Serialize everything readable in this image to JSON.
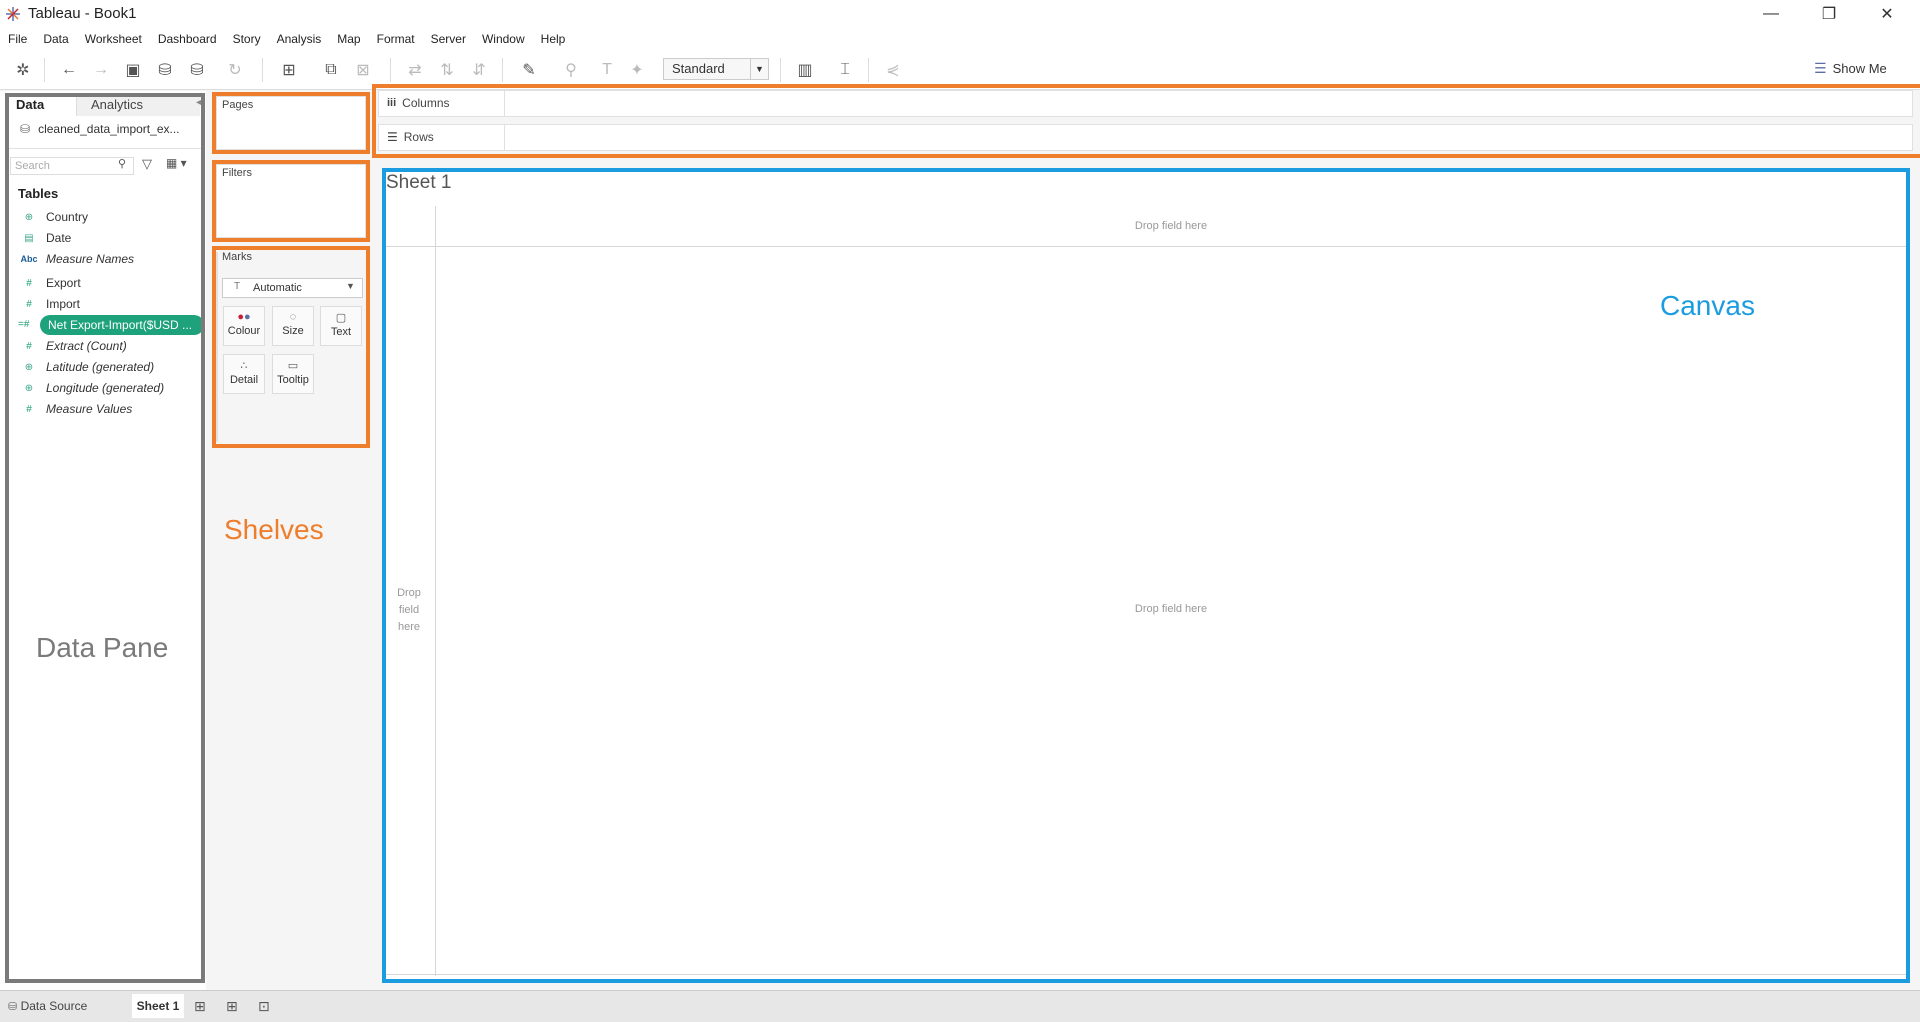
{
  "window": {
    "title": "Tableau - Book1",
    "minimize": "—",
    "restore": "❐",
    "close": "✕"
  },
  "menu": [
    "File",
    "Data",
    "Worksheet",
    "Dashboard",
    "Story",
    "Analysis",
    "Map",
    "Format",
    "Server",
    "Window",
    "Help"
  ],
  "toolbar": {
    "fit_select": "Standard",
    "show_me": "Show Me"
  },
  "data_pane": {
    "tabs": {
      "data": "Data",
      "analytics": "Analytics"
    },
    "datasource": "cleaned_data_import_ex...",
    "search_placeholder": "Search",
    "tables_header": "Tables",
    "fields": [
      {
        "name": "Country",
        "icon": "globe-icon"
      },
      {
        "name": "Date",
        "icon": "calendar-icon"
      },
      {
        "name": "Measure Names",
        "icon": "abc-icon"
      },
      {
        "name": "Export",
        "icon": "hash-icon"
      },
      {
        "name": "Import",
        "icon": "hash-icon"
      },
      {
        "name": "Net Export-Import($USD ...",
        "icon": "calc-hash-icon"
      },
      {
        "name": "Extract (Count)",
        "icon": "hash-icon"
      },
      {
        "name": "Latitude (generated)",
        "icon": "globe-icon"
      },
      {
        "name": "Longitude (generated)",
        "icon": "globe-icon"
      },
      {
        "name": "Measure Values",
        "icon": "hash-icon"
      }
    ]
  },
  "shelves": {
    "pages": "Pages",
    "filters": "Filters",
    "marks": "Marks",
    "mark_type": "Automatic",
    "mark_buttons": [
      "Colour",
      "Size",
      "Text",
      "Detail",
      "Tooltip"
    ],
    "columns": "Columns",
    "rows": "Rows"
  },
  "canvas": {
    "sheet_title": "Sheet 1",
    "drop_top": "Drop field here",
    "drop_left_1": "Drop",
    "drop_left_2": "field",
    "drop_left_3": "here",
    "drop_center": "Drop field here"
  },
  "annotations": {
    "data_pane": "Data Pane",
    "shelves": "Shelves",
    "canvas": "Canvas",
    "colors": {
      "gray": "#7a7a7a",
      "orange": "#ee7d2c",
      "blue": "#1b9be0"
    }
  },
  "bottom_tabs": {
    "data_source": "Data Source",
    "sheet1": "Sheet 1"
  }
}
